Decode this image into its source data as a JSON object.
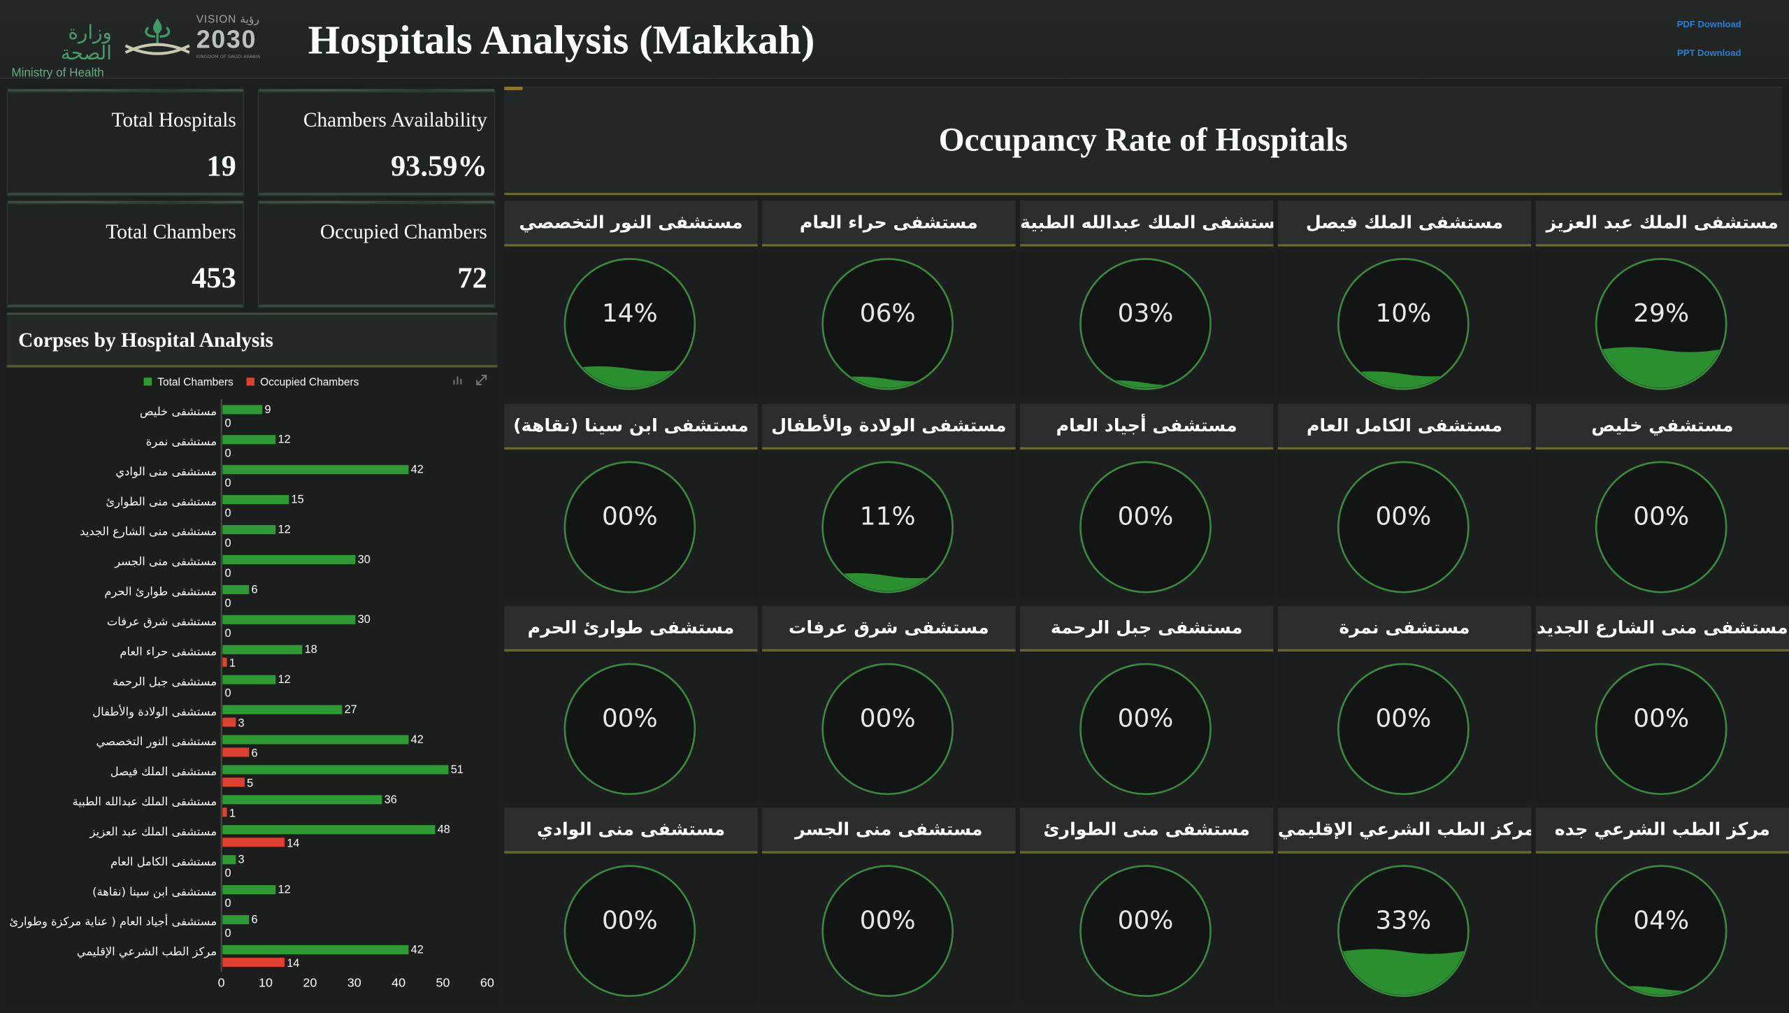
{
  "header": {
    "moh_arabic": "وزارة الصحة",
    "moh_english": "Ministry of Health",
    "vision_label": "VISION رؤية",
    "vision_year": "2030",
    "vision_kingdom": "KINGDOM OF SAUDI ARABIA",
    "title": "Hospitals Analysis (Makkah)",
    "pdf_download": "PDF Download",
    "ppt_download": "PPT Download"
  },
  "kpis": {
    "total_hospitals": {
      "label": "Total Hospitals",
      "value": "19"
    },
    "chambers_availability": {
      "label": "Chambers Availability",
      "value": "93.59%"
    },
    "total_chambers": {
      "label": "Total Chambers",
      "value": "453"
    },
    "occupied_chambers": {
      "label": "Occupied Chambers",
      "value": "72"
    }
  },
  "corpses_section": {
    "title": "Corpses by Hospital Analysis"
  },
  "colors": {
    "total": "#2e9a33",
    "occupied": "#e0402f",
    "accent_line": "#6a6a2a",
    "gauge_fill": "#2a8f2e"
  },
  "chart_data": {
    "type": "bar",
    "orientation": "horizontal",
    "categories": [
      "مستشفى خليص",
      "مستشفى نمرة",
      "مستشفى منى الوادي",
      "مستشفى منى الطوارئ",
      "مستشفى منى الشارع الجديد",
      "مستشفى منى الجسر",
      "مستشفى طوارئ الحرم",
      "مستشفى شرق عرفات",
      "مستشفى حراء العام",
      "مستشفى جبل الرحمة",
      "مستشفى الولادة والأطفال",
      "مستشفى النور التخصصي",
      "مستشفى الملك فيصل",
      "مستشفى الملك عبدالله الطبية",
      "مستشفى الملك عبد العزيز",
      "مستشفى الكامل العام",
      "مستشفى ابن سينا (نقاهة)",
      "مستشفى أجياد العام ( عناية مركزة وطوارئ )",
      "مركز الطب الشرعي الإقليمي"
    ],
    "series": [
      {
        "name": "Total Chambers",
        "values": [
          9,
          12,
          42,
          15,
          12,
          30,
          6,
          30,
          18,
          12,
          27,
          42,
          51,
          36,
          48,
          3,
          12,
          6,
          42
        ]
      },
      {
        "name": "Occupied Chambers",
        "values": [
          0,
          0,
          0,
          0,
          0,
          0,
          0,
          0,
          1,
          0,
          3,
          6,
          5,
          1,
          14,
          0,
          0,
          0,
          14
        ]
      }
    ],
    "xlim": [
      0,
      60
    ],
    "xticks": [
      "0",
      "10",
      "20",
      "30",
      "40",
      "50",
      "60"
    ],
    "legend_position": "top"
  },
  "occupancy": {
    "title": "Occupancy Rate of Hospitals",
    "hospitals": [
      {
        "name": "مستشفى الملك عبد العزيز",
        "rate": 29,
        "label": "29%"
      },
      {
        "name": "مستشفى الملك فيصل",
        "rate": 10,
        "label": "10%"
      },
      {
        "name": "مستشفى الملك عبدالله الطبية",
        "rate": 3,
        "label": "03%"
      },
      {
        "name": "مستشفى حراء العام",
        "rate": 6,
        "label": "06%"
      },
      {
        "name": "مستشفى النور التخصصي",
        "rate": 14,
        "label": "14%"
      },
      {
        "name": "مستشفي خليص",
        "rate": 0,
        "label": "00%"
      },
      {
        "name": "مستشفى الكامل العام",
        "rate": 0,
        "label": "00%"
      },
      {
        "name": "مستشفى أجياد العام",
        "rate": 0,
        "label": "00%"
      },
      {
        "name": "مستشفى الولادة والأطفال",
        "rate": 11,
        "label": "11%"
      },
      {
        "name": "مستشفى ابن سينا (نقاهة)",
        "rate": 0,
        "label": "00%"
      },
      {
        "name": "مستشفى منى الشارع الجديد",
        "rate": 0,
        "label": "00%"
      },
      {
        "name": "مستشفى نمرة",
        "rate": 0,
        "label": "00%"
      },
      {
        "name": "مستشفى جبل الرحمة",
        "rate": 0,
        "label": "00%"
      },
      {
        "name": "مستشفى شرق عرفات",
        "rate": 0,
        "label": "00%"
      },
      {
        "name": "مستشفى طوارئ الحرم",
        "rate": 0,
        "label": "00%"
      },
      {
        "name": "مركز الطب الشرعي جده",
        "rate": 4,
        "label": "04%"
      },
      {
        "name": "مركز الطب الشرعي الإقليمي",
        "rate": 33,
        "label": "33%"
      },
      {
        "name": "مستشفى منى الطوارئ",
        "rate": 0,
        "label": "00%"
      },
      {
        "name": "مستشفى منى الجسر",
        "rate": 0,
        "label": "00%"
      },
      {
        "name": "مستشفى منى الوادي",
        "rate": 0,
        "label": "00%"
      }
    ]
  }
}
